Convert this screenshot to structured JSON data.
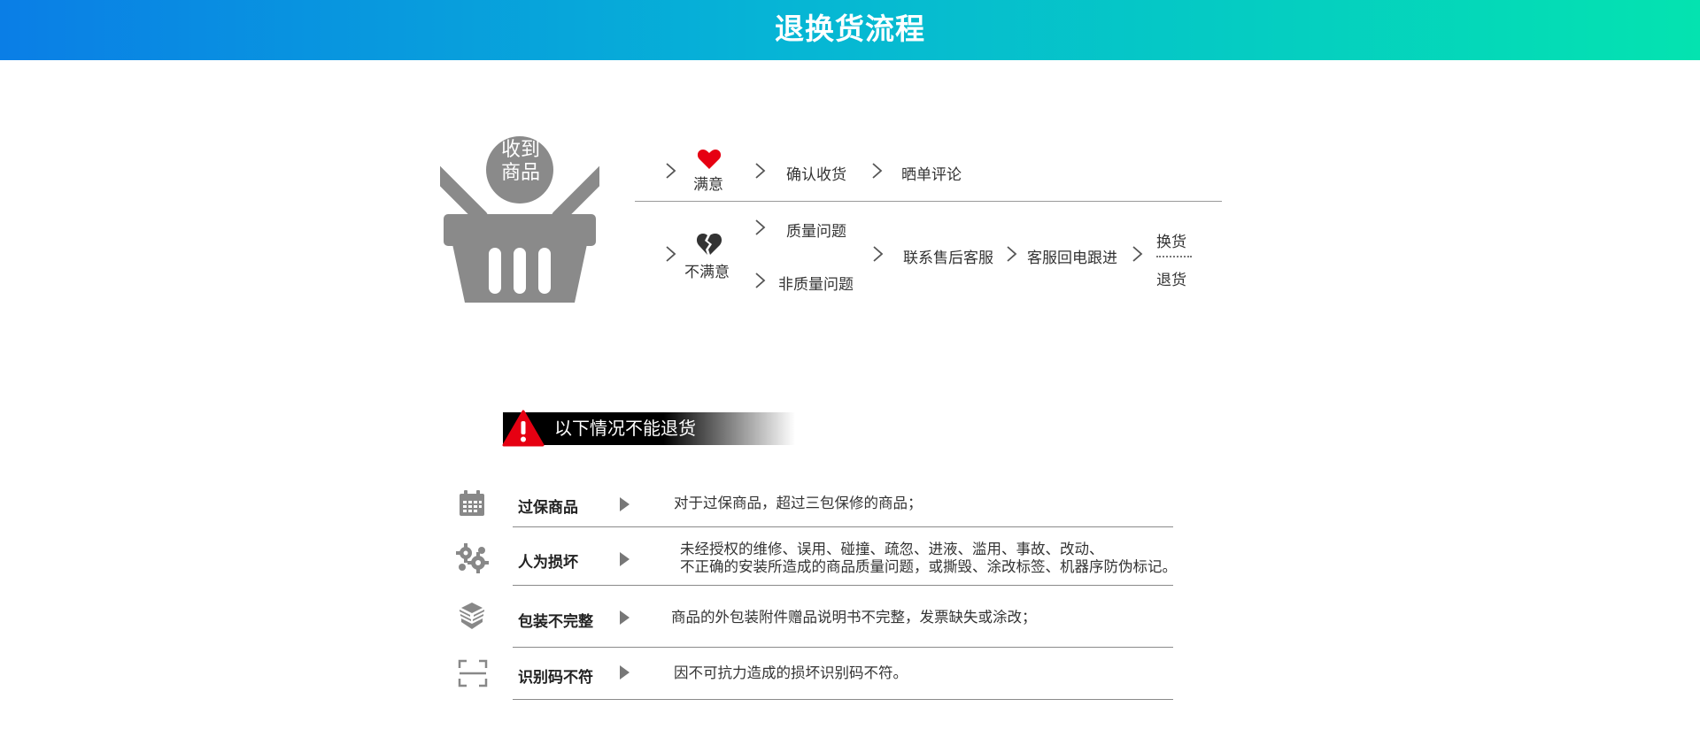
{
  "header": {
    "title": "退换货流程"
  },
  "flow": {
    "start_label_line1": "收到",
    "start_label_line2": "商品",
    "satisfied": {
      "label": "满意",
      "steps": [
        "确认收货",
        "晒单评论"
      ]
    },
    "unsatisfied": {
      "label": "不满意",
      "branches": [
        "质量问题",
        "非质量问题"
      ],
      "steps": [
        "联系售后客服",
        "客服回电跟进"
      ],
      "outcomes": [
        "换货",
        "退货"
      ]
    }
  },
  "warning": {
    "title": "以下情况不能退货"
  },
  "rules": [
    {
      "icon": "calendar-icon",
      "label": "过保商品",
      "desc": [
        "对于过保商品，超过三包保修的商品；"
      ]
    },
    {
      "icon": "broken-gear-icon",
      "label": "人为损坏",
      "desc": [
        "未经授权的维修、误用、碰撞、疏忽、进液、滥用、事故、改动、",
        "不正确的安装所造成的商品质量问题，或撕毁、涂改标签、机器序防伪标记。"
      ]
    },
    {
      "icon": "open-box-icon",
      "label": "包装不完整",
      "desc": [
        "商品的外包装附件赠品说明书不完整，发票缺失或涂改；"
      ]
    },
    {
      "icon": "scan-code-icon",
      "label": "识别码不符",
      "desc": [
        "因不可抗力造成的损坏识别码不符。"
      ]
    }
  ],
  "colors": {
    "accent_start": "#0a7ee6",
    "accent_end": "#04e3b0",
    "heart": "#e60012",
    "warning": "#e60012",
    "icon_gray": "#888888"
  }
}
